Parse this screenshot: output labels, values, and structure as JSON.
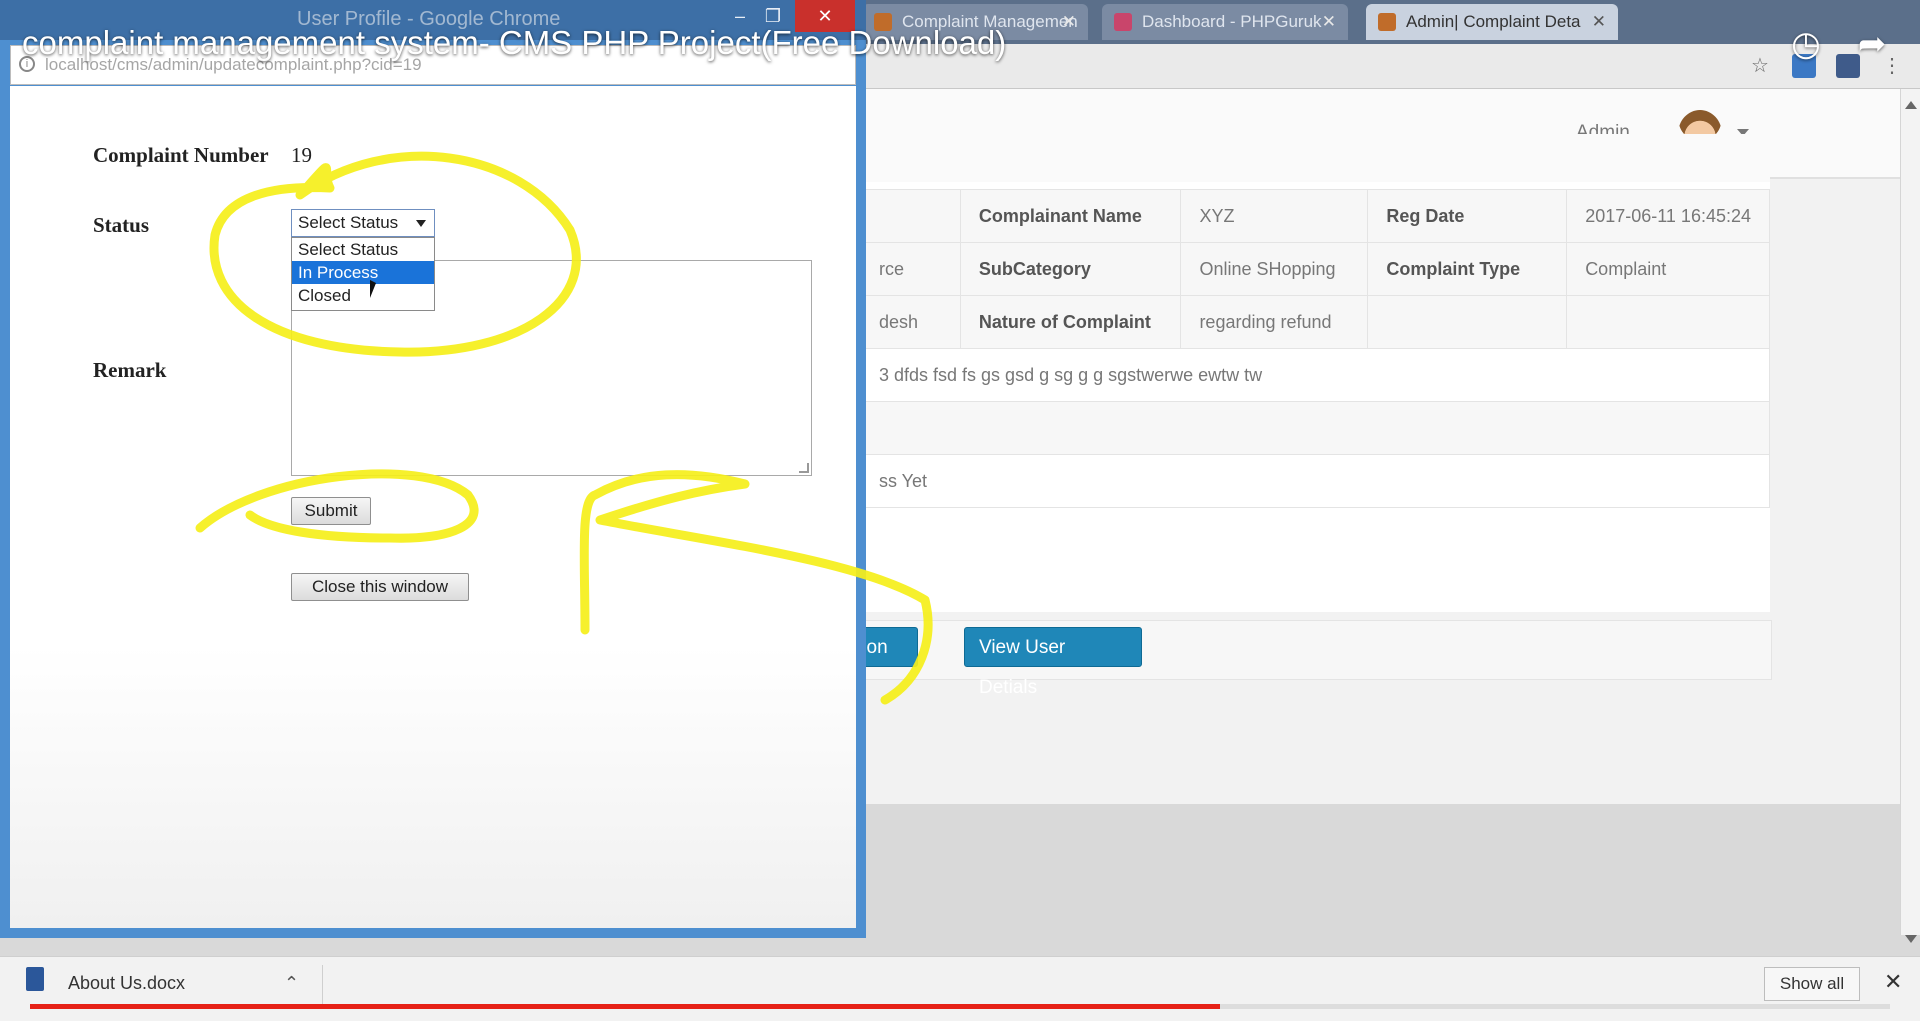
{
  "browser_bg": {
    "tabs": [
      {
        "label": "Complaint Managemen",
        "active": false
      },
      {
        "label": "Dashboard - PHPGuruk",
        "active": false
      },
      {
        "label": "Admin| Complaint Deta",
        "active": true
      }
    ],
    "header": {
      "admin_label": "Admin"
    },
    "details_table": {
      "rows": [
        [
          "",
          "Complainant Name",
          "XYZ",
          "Reg Date",
          "2017-06-11 16:45:24"
        ],
        [
          "rce",
          "SubCategory",
          "Online SHopping",
          "Complaint Type",
          "Complaint"
        ],
        [
          "desh",
          "Nature of Complaint",
          "regarding refund",
          "",
          ""
        ],
        [
          "3 dfds fsd fs gs gsd g sg g g sgstwerwe ewtw tw"
        ],
        [
          ""
        ],
        [
          "ss Yet"
        ]
      ]
    },
    "buttons": {
      "action_label": "tion",
      "view_user_label": "View User Detials"
    }
  },
  "popup": {
    "window_title": "User Profile - Google Chrome",
    "address": "localhost/cms/admin/updatecomplaint.php?cid=19",
    "complaint_number_label": "Complaint Number",
    "complaint_number_value": "19",
    "status_label": "Status",
    "status_selected": "Select Status",
    "status_options": [
      "Select Status",
      "In Process",
      "Closed"
    ],
    "highlighted_option": "In Process",
    "remark_label": "Remark",
    "remark_value": "",
    "submit_label": "Submit",
    "close_window_label": "Close this window"
  },
  "video": {
    "title": "complaint management system- CMS PHP Project(Free Download)",
    "progress_fraction": 0.64,
    "progress_color": "#e62117",
    "icons": [
      "clock-icon",
      "share-icon"
    ]
  },
  "downloads": {
    "file_name": "About Us.docx",
    "show_all_label": "Show all"
  },
  "colors": {
    "annotation": "#f5ef1a",
    "primary_button": "#1f87b8",
    "popup_frame": "#4e8fd0"
  }
}
